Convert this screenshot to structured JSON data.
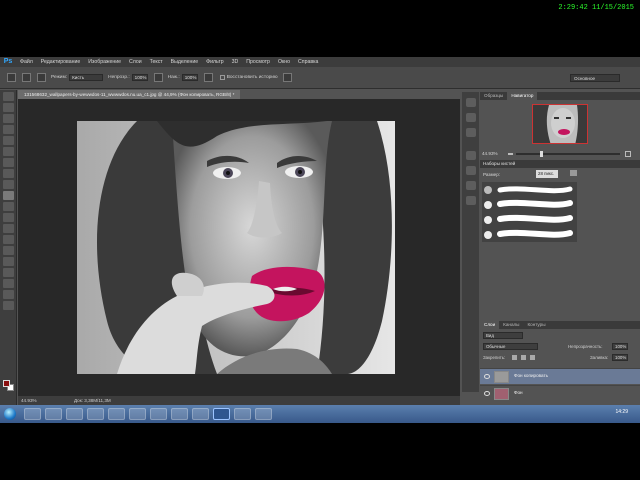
{
  "clock_overlay": "2:29:42  11/15/2015",
  "menu": {
    "logo": "Ps",
    "items": [
      "Файл",
      "Редактирование",
      "Изображение",
      "Слои",
      "Текст",
      "Выделение",
      "Фильтр",
      "3D",
      "Просмотр",
      "Окно",
      "Справка"
    ]
  },
  "options": {
    "mode_label": "Режим:",
    "mode_value": "Кисть",
    "opacity_label": "Непрозр.:",
    "opacity_value": "100%",
    "pressure_label": "Наж.:",
    "pressure_value": "100%",
    "history_label": "Восстановить историю",
    "workspace": "Основное"
  },
  "document": {
    "tab_title": "131568632_wallpapers-by-wewwdos-11_wwwwdos.nu.ua_c1.jpg @ 44,9% (Фон копировать, RGB/8) *",
    "zoom": "44.93%",
    "doc_size": "Док: 3,38М/11,3М"
  },
  "navigator": {
    "tabs": [
      "Образцы",
      "Навигатор"
    ],
    "zoom": "44.93%"
  },
  "brush_presets": {
    "title": "Наборы кистей",
    "size_label": "Размер:",
    "size_value": "28 пикс."
  },
  "layers": {
    "tabs": [
      "Слои",
      "Каналы",
      "Контуры"
    ],
    "filter_value": "Вид",
    "blend_mode": "Обычные",
    "opacity_label": "Непрозрачность:",
    "opacity_value": "100%",
    "lock_label": "Закрепить:",
    "fill_label": "Заливка:",
    "fill_value": "100%",
    "items": [
      {
        "name": "Фон копировать",
        "selected": true
      },
      {
        "name": "Фон",
        "selected": false
      }
    ]
  },
  "taskbar": {
    "time": "14:29"
  },
  "colors": {
    "foreground": "#8a1010",
    "background": "#ffffff",
    "accent": "#31a8ff"
  }
}
